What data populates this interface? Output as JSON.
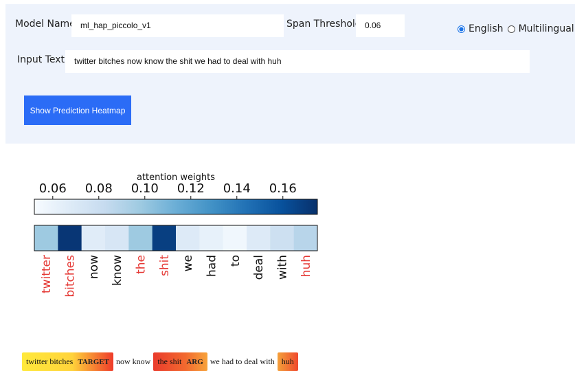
{
  "form": {
    "model_name_label": "Model Name:",
    "model_name_value": "ml_hap_piccolo_v1",
    "span_threshold_label": "Span Threshold:",
    "span_threshold_value": "0.06",
    "language_options": [
      {
        "label": "English",
        "selected": true
      },
      {
        "label": "Multilingual",
        "selected": false
      }
    ],
    "input_text_label": "Input Text:",
    "input_text_value": "twitter bitches now know the shit we had to deal with huh",
    "button_label": "Show Prediction Heatmap"
  },
  "colors": {
    "panel_bg": "#eef3fc",
    "button_bg": "#2b6cf6",
    "highlight_word": "#e53935",
    "accent_radio": "#1a73e8"
  },
  "chart_data": {
    "type": "heatmap",
    "colorbar_label": "attention weights",
    "colorbar_ticks": [
      "0.06",
      "0.08",
      "0.10",
      "0.12",
      "0.14",
      "0.16"
    ],
    "colorbar_tick_values": [
      0.06,
      0.08,
      0.1,
      0.12,
      0.14,
      0.16
    ],
    "vmin": 0.052,
    "vmax": 0.175,
    "colormap": "Blues",
    "tokens": [
      "twitter",
      "bitches",
      "now",
      "know",
      "the",
      "shit",
      "we",
      "had",
      "to",
      "deal",
      "with",
      "huh"
    ],
    "values": [
      0.098,
      0.172,
      0.066,
      0.072,
      0.098,
      0.168,
      0.068,
      0.062,
      0.056,
      0.068,
      0.078,
      0.088
    ],
    "highlighted_tokens": [
      true,
      true,
      false,
      false,
      true,
      true,
      false,
      false,
      false,
      false,
      false,
      true
    ]
  },
  "spans": [
    {
      "text": "twitter bitches",
      "tag": "TARGET",
      "highlighted": true
    },
    {
      "text": "now know",
      "tag": "",
      "highlighted": false
    },
    {
      "text": "the shit",
      "tag": "ARG",
      "highlighted": true
    },
    {
      "text": "we had to deal with",
      "tag": "",
      "highlighted": false
    },
    {
      "text": "huh",
      "tag": "",
      "highlighted": true
    }
  ]
}
